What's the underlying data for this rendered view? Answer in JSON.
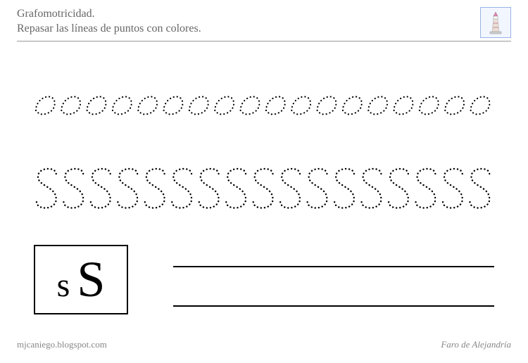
{
  "header": {
    "title": "Grafomotricidad.",
    "subtitle": "Repasar las líneas de puntos con colores."
  },
  "tracing": {
    "row1_letter": "s",
    "row1_count": 18,
    "row2_letter": "S",
    "row2_count": 17
  },
  "letterbox": {
    "lower": "s",
    "upper": "S"
  },
  "footer": {
    "left": "mjcaniego.blogspot.com",
    "right": "Faro de Alejandría"
  }
}
